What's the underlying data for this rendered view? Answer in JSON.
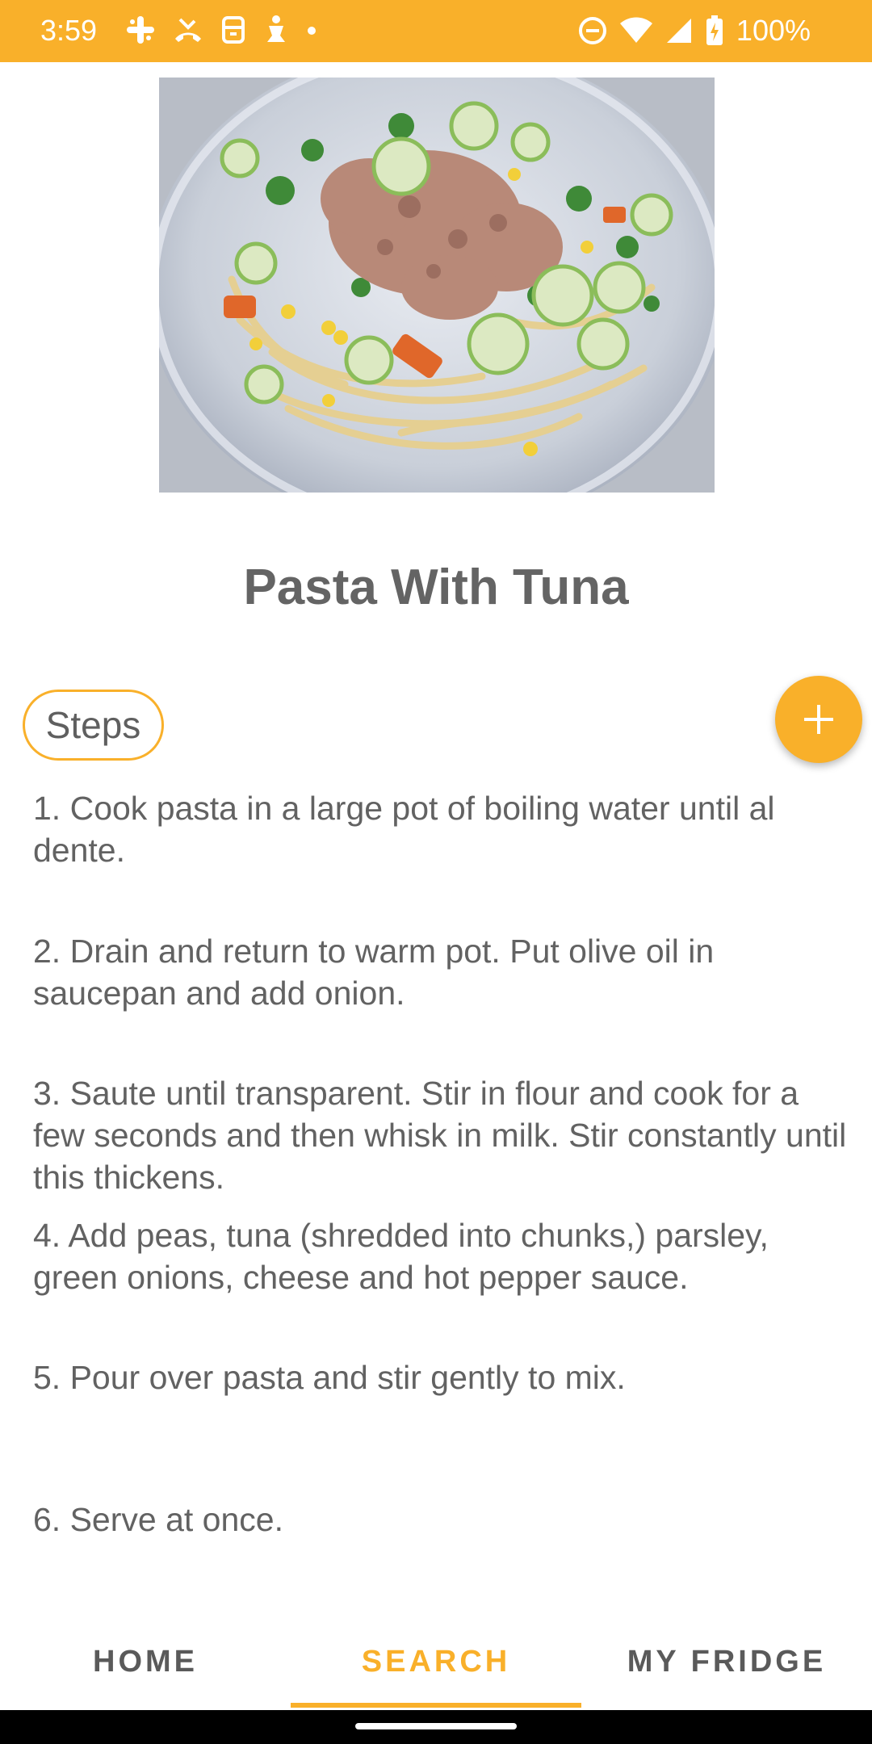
{
  "status_bar": {
    "time": "3:59",
    "battery": "100%",
    "notification_icons": [
      "slack-icon",
      "missed-call-icon",
      "lunch-icon",
      "accessibility-icon",
      "dot-icon"
    ],
    "system_icons": [
      "do-not-disturb-icon",
      "wifi-icon",
      "signal-icon",
      "battery-charging-icon"
    ],
    "color": "#F9B02A"
  },
  "recipe": {
    "image_alt": "Pasta with tuna in a white bowl",
    "title": "Pasta With Tuna"
  },
  "steps_section": {
    "chip_label": "Steps",
    "add_button_icon": "plus-icon"
  },
  "steps": [
    "1. Cook pasta in a large pot of boiling water until al dente.",
    "2. Drain and return to warm pot. Put olive oil in saucepan and add onion.",
    "3. Saute until transparent. Stir in flour and cook for a few seconds and then whisk in milk. Stir constantly until this thickens.",
    "4. Add peas, tuna (shredded into chunks,) parsley, green onions, cheese and hot pepper sauce.",
    "5. Pour over pasta and stir gently to mix.",
    "6. Serve at once."
  ],
  "bottom_nav": {
    "tabs": [
      {
        "label": "HOME",
        "active": false
      },
      {
        "label": "SEARCH",
        "active": true
      },
      {
        "label": "MY FRIDGE",
        "active": false
      }
    ],
    "active_color": "#F9B02A"
  }
}
